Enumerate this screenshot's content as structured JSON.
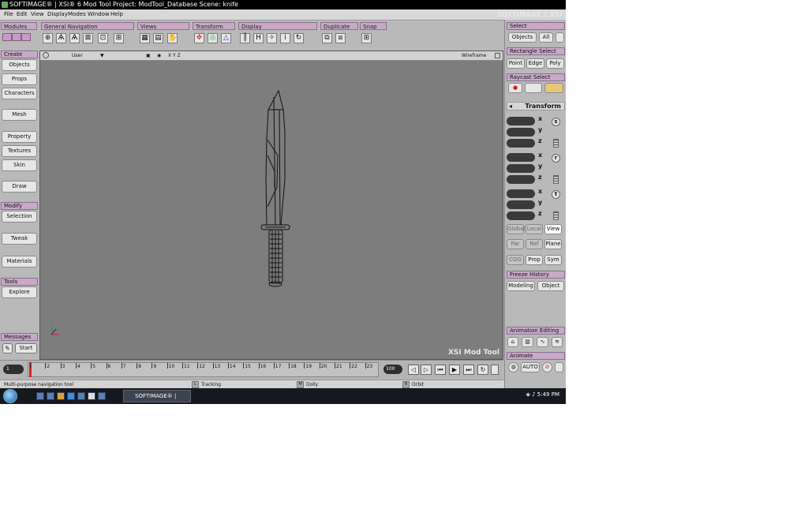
{
  "window": {
    "title": "SOFTIMAGE® | XSI® 6 Mod Tool Project: ModTool_Database    Scene: knife",
    "brand": "SOFTIMAGE | XSI"
  },
  "menu": [
    "File",
    "Edit",
    "View",
    "Display",
    "Modes",
    "Window",
    "Help"
  ],
  "toolbar_sections": {
    "modules": "Modules",
    "general_navigation": "General Navigation",
    "views": "Views",
    "transform": "Transform",
    "display": "Display",
    "duplicate": "Duplicate",
    "snap": "Snap"
  },
  "left_panel": {
    "create_header": "Create",
    "create_items": [
      "Objects",
      "Props",
      "Characters",
      "Mesh",
      "Property",
      "Textures",
      "Skin",
      "Draw"
    ],
    "modify_header": "Modify",
    "modify_items": [
      "Selection",
      "Tweak",
      "Materials"
    ],
    "tools_header": "Tools",
    "tools_items": [
      "Explore"
    ],
    "messages_header": "Messages",
    "start_label": "Start"
  },
  "viewport": {
    "camera_label": "User",
    "axis_filter": "X Y Z",
    "display_mode": "Wireframe",
    "watermark": "XSI Mod Tool"
  },
  "timeline": {
    "current_frame": "1",
    "end_frame": "100",
    "ticks": [
      "1",
      "2",
      "3",
      "4",
      "5",
      "6",
      "7",
      "8",
      "9",
      "10",
      "11",
      "12",
      "13",
      "14",
      "15",
      "16",
      "17",
      "18",
      "19",
      "20",
      "21",
      "22",
      "23"
    ]
  },
  "status": {
    "message": "Multi-purpose navigation tool",
    "left_key": "L",
    "left_action": "Tracking",
    "middle_key": "M",
    "middle_action": "Dolly",
    "right_key": "R",
    "right_action": "Orbit"
  },
  "right_panel": {
    "select_header": "Select",
    "select_buttons": [
      "Objects",
      "All"
    ],
    "rect_select_header": "Rectangle Select",
    "rect_select_buttons": [
      "Point",
      "Edge",
      "Poly"
    ],
    "raycast_header": "Raycast Select",
    "transform_header": "Transform",
    "axes": [
      "x",
      "y",
      "z"
    ],
    "scale_label": "s",
    "rotate_label": "r",
    "translate_label": "t",
    "space_buttons": [
      "Global",
      "Local",
      "View"
    ],
    "ref_buttons": [
      "Par",
      "Ref",
      "Plane"
    ],
    "option_buttons": [
      "COG",
      "Prop",
      "Sym"
    ],
    "freeze_header": "Freeze History",
    "freeze_buttons": [
      "Modeling",
      "Object"
    ],
    "anim_edit_header": "Animation Editing",
    "anim_header": "Animate",
    "auto_label": "AUTO"
  },
  "taskbar": {
    "task_label": "SOFTIMAGE® | XSI...",
    "clock": "5:49 PM"
  }
}
